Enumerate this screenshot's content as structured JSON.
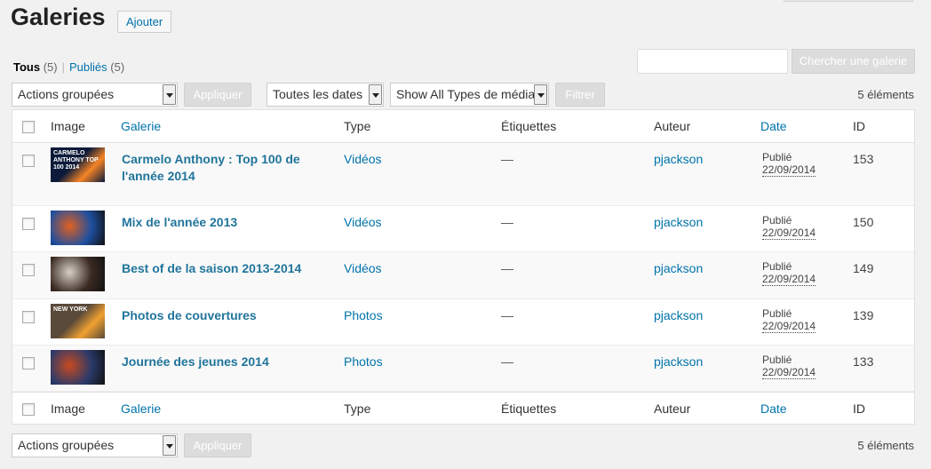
{
  "header": {
    "title": "Galeries",
    "add_label": "Ajouter"
  },
  "views": {
    "all_label": "Tous",
    "all_count": "(5)",
    "separator": "|",
    "published_label": "Publiés",
    "published_count": "(5)"
  },
  "search": {
    "value": "",
    "button_label": "Chercher une galerie"
  },
  "filters": {
    "bulk_actions": "Actions groupées",
    "apply_label": "Appliquer",
    "dates": "Toutes les dates",
    "media_types": "Show All Types de média",
    "filter_label": "Filtrer",
    "item_count": "5 éléments"
  },
  "columns": {
    "image": "Image",
    "gallery": "Galerie",
    "type": "Type",
    "tags": "Étiquettes",
    "author": "Auteur",
    "date": "Date",
    "id": "ID"
  },
  "rows": [
    {
      "title": "Carmelo Anthony : Top 100 de l'année 2014",
      "type": "Vidéos",
      "tags": "—",
      "author": "pjackson",
      "status": "Publié",
      "date": "22/09/2014",
      "id": "153",
      "thumb_text": "CARMELO ANTHONY TOP 100 2014",
      "thumb_colors": [
        "#0b1a3a",
        "#f58426"
      ]
    },
    {
      "title": "Mix de l'année 2013",
      "type": "Vidéos",
      "tags": "—",
      "author": "pjackson",
      "status": "Publié",
      "date": "22/09/2014",
      "id": "150",
      "thumb_colors": [
        "#1d4fa0",
        "#e06020"
      ]
    },
    {
      "title": "Best of de la saison 2013-2014",
      "type": "Vidéos",
      "tags": "—",
      "author": "pjackson",
      "status": "Publié",
      "date": "22/09/2014",
      "id": "149",
      "thumb_colors": [
        "#3a2a22",
        "#d8d0c8"
      ]
    },
    {
      "title": "Photos de couvertures",
      "type": "Photos",
      "tags": "—",
      "author": "pjackson",
      "status": "Publié",
      "date": "22/09/2014",
      "id": "139",
      "thumb_text": "NEW YORK",
      "thumb_colors": [
        "#5a4a3a",
        "#f0a030"
      ]
    },
    {
      "title": "Journée des jeunes 2014",
      "type": "Photos",
      "tags": "—",
      "author": "pjackson",
      "status": "Publié",
      "date": "22/09/2014",
      "id": "133",
      "thumb_colors": [
        "#2a3a6a",
        "#c84a20"
      ]
    }
  ]
}
